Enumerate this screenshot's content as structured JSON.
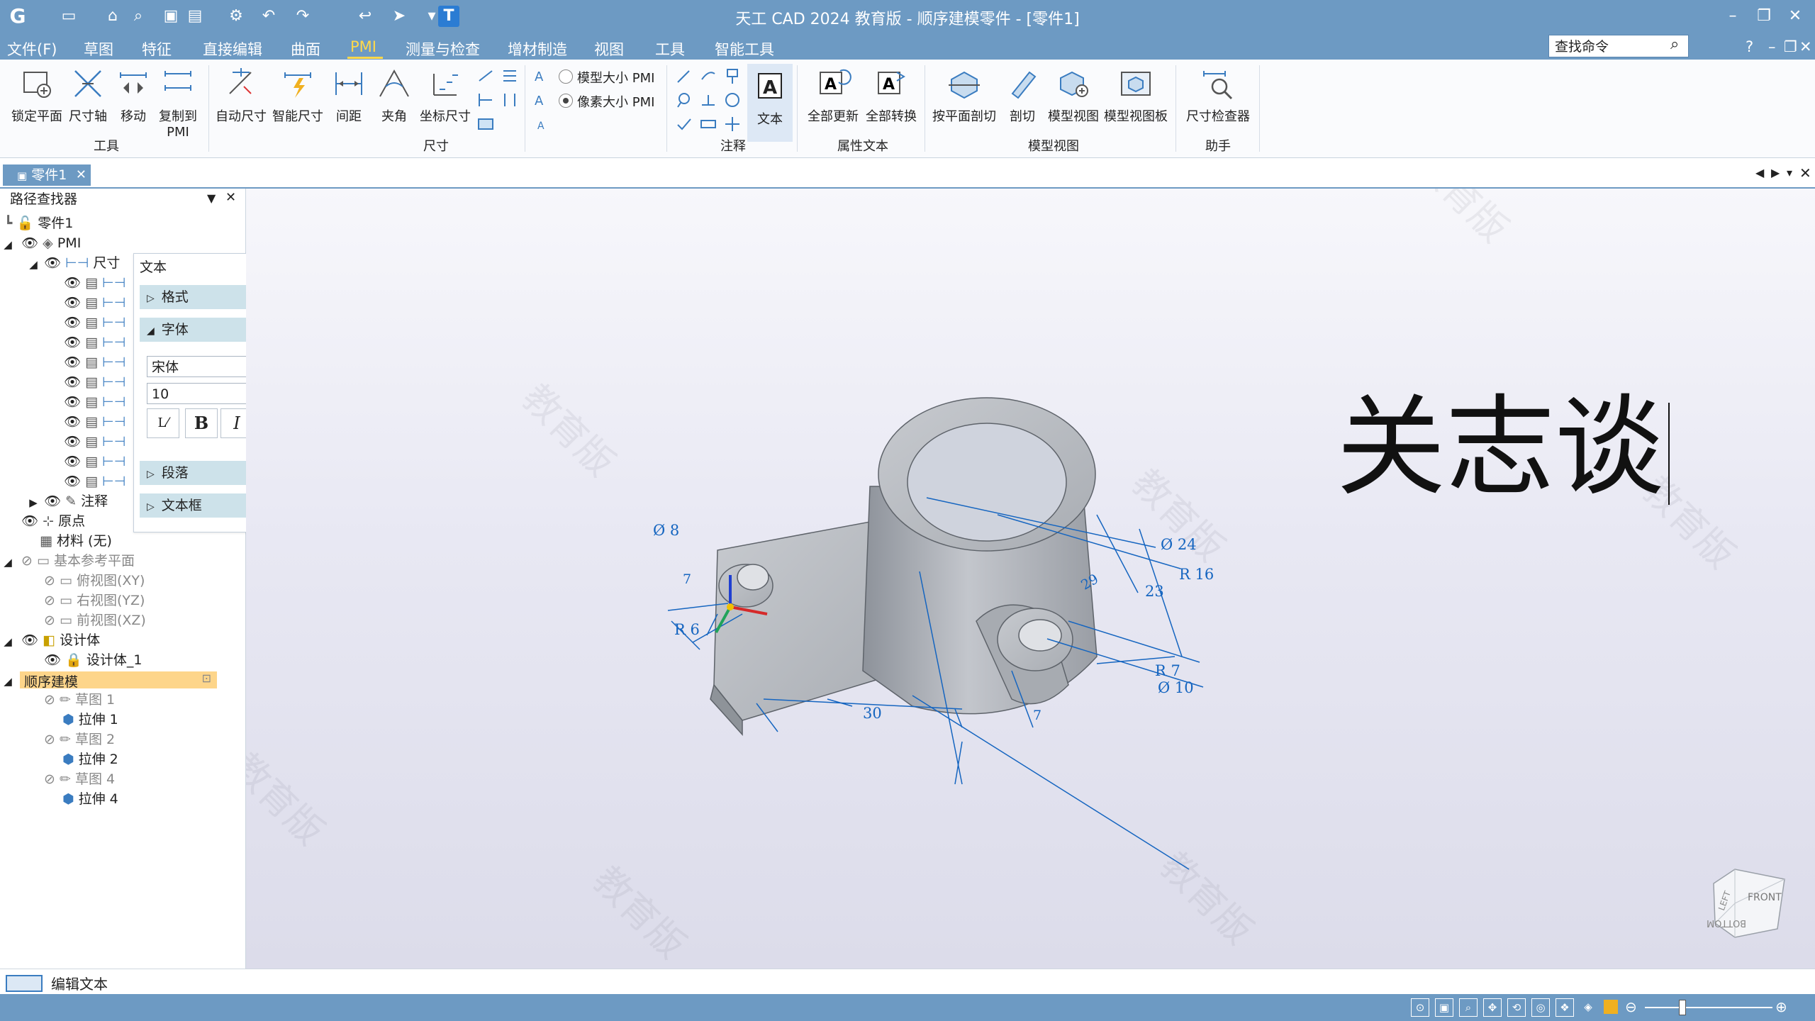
{
  "window": {
    "title": "天工 CAD 2024 教育版 - 顺序建模零件 - [零件1]",
    "minimize": "–",
    "restore": "❐",
    "close": "✕"
  },
  "menu": {
    "file": "文件(F)",
    "items": [
      "草图",
      "特征",
      "直接编辑",
      "曲面",
      "PMI",
      "测量与检查",
      "增材制造",
      "视图",
      "工具",
      "智能工具"
    ],
    "active": "PMI",
    "help": "?"
  },
  "search": {
    "placeholder": "查找命令"
  },
  "ribbon": {
    "tools": {
      "label": "工具",
      "lock": "锁定平面",
      "axis": "尺寸轴",
      "move": "移动",
      "copy1": "复制到",
      "copy2": "PMI"
    },
    "dims": {
      "label": "尺寸",
      "auto": "自动尺寸",
      "smart": "智能尺寸",
      "spacing": "间距",
      "angle": "夹角",
      "coord": "坐标尺寸"
    },
    "pmisize": {
      "model": "模型大小 PMI",
      "pixel": "像素大小 PMI"
    },
    "annot": {
      "label": "注释",
      "text": "文本"
    },
    "attr": {
      "label": "属性文本",
      "updateAll": "全部更新",
      "convertAll": "全部转换"
    },
    "modelview": {
      "label": "模型视图",
      "planeSection": "按平面剖切",
      "section": "剖切",
      "view": "模型视图",
      "board": "模型视图板"
    },
    "assist": {
      "label": "助手",
      "checker": "尺寸检查器"
    }
  },
  "tabs": {
    "doc": "零件1"
  },
  "tree": {
    "title": "路径查找器",
    "root": "零件1",
    "pmi": "PMI",
    "dims": "尺寸",
    "notes": "注释",
    "origin": "原点",
    "material": "材料 (无)",
    "planes": "基本参考平面",
    "top": "俯视图(XY)",
    "right": "右视图(YZ)",
    "front": "前视图(XZ)",
    "design": "设计体",
    "design1": "设计体_1",
    "seq": "顺序建模",
    "sketch1": "草图 1",
    "ext1": "拉伸 1",
    "sketch2": "草图 2",
    "ext2": "拉伸 2",
    "sketch4": "草图 4",
    "ext4": "拉伸 4"
  },
  "dialog": {
    "title": "文本",
    "format": "格式",
    "font": "字体",
    "fontName": "宋体",
    "fontSize": "10",
    "bold": "B",
    "italic": "I",
    "underline": "U",
    "para": "段落",
    "frame": "文本框"
  },
  "canvas": {
    "text": "关志谈",
    "watermark": "教育版",
    "dims": [
      "Ø 8",
      "Ø 24",
      "R 16",
      "29",
      "23",
      "R 6",
      "R 7",
      "Ø 10",
      "30",
      "7",
      "7"
    ],
    "cube": {
      "front": "FRONT",
      "left": "LEFT",
      "bottom": "BOTTOM"
    }
  },
  "status": {
    "message": "编辑文本"
  },
  "colors": {
    "titlebar": "#6d9ac3",
    "accent": "#ffd84a",
    "dim": "#1565c0"
  }
}
